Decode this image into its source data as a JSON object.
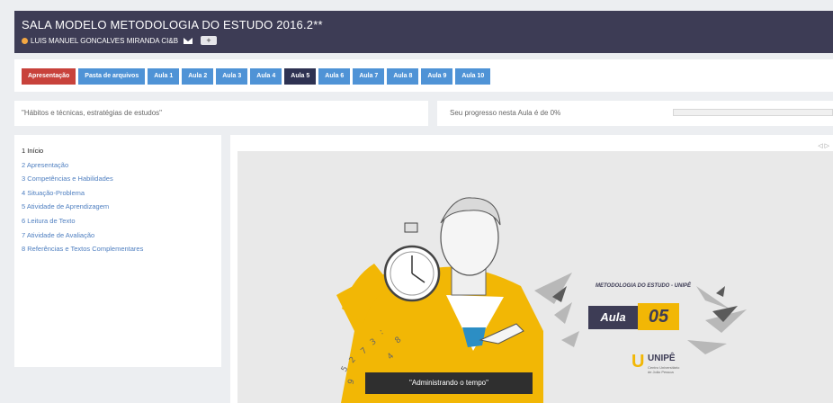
{
  "header": {
    "title": "SALA MODELO METODOLOGIA DO ESTUDO 2016.2**",
    "user": "LUIS MANUEL GONCALVES MIRANDA CI&B",
    "plus_label": "+"
  },
  "tabs": [
    {
      "label": "Apresentação",
      "style": "red"
    },
    {
      "label": "Pasta de arquivos",
      "style": "blue"
    },
    {
      "label": "Aula 1",
      "style": "blue"
    },
    {
      "label": "Aula 2",
      "style": "blue"
    },
    {
      "label": "Aula 3",
      "style": "blue"
    },
    {
      "label": "Aula 4",
      "style": "blue"
    },
    {
      "label": "Aula 5",
      "style": "dark"
    },
    {
      "label": "Aula 6",
      "style": "blue"
    },
    {
      "label": "Aula 7",
      "style": "blue"
    },
    {
      "label": "Aula 8",
      "style": "blue"
    },
    {
      "label": "Aula 9",
      "style": "blue"
    },
    {
      "label": "Aula 10",
      "style": "blue"
    }
  ],
  "subtitle": "\"Hábitos e técnicas, estratégias de estudos\"",
  "progress": {
    "label": "Seu progresso nesta Aula é de 0%",
    "value": 0
  },
  "sidebar": {
    "items": [
      "1 Início",
      "2 Apresentação",
      "3 Competências e Habilidades",
      "4 Situação-Problema",
      "5 Atividade de Aprendizagem",
      "6 Leitura de Texto",
      "7 Atividade de Avaliação",
      "8 Referências e Textos Complementares"
    ],
    "active_index": 0
  },
  "slide": {
    "heading": "METODOLOGIA DO ESTUDO - UNIPÊ",
    "aula_word": "Aula",
    "aula_number": "05",
    "logo_name": "UNIPÊ",
    "logo_letter": "U",
    "logo_sub_1": "Centro Universitário",
    "logo_sub_2": "de João Pessoa",
    "caption": "\"Administrando o tempo\""
  },
  "colors": {
    "header_bg": "#3d3c55",
    "tab_blue": "#4f93d6",
    "tab_red": "#c8423b",
    "tab_active": "#2e3252",
    "accent_yellow": "#f2b705"
  },
  "icons": {
    "user": "user-icon",
    "mail": "envelope-icon",
    "nav_prev": "triangle-left-icon",
    "nav_next": "triangle-right-icon"
  }
}
